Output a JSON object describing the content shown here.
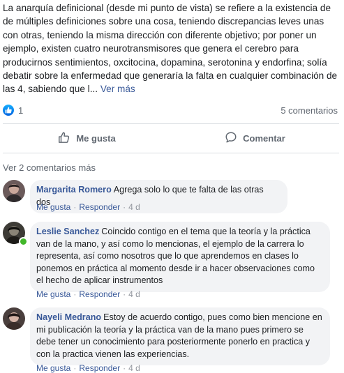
{
  "post": {
    "text": "La anarquía definicional (desde mi punto de vista) se refiere a la existencia de de múltiples definiciones sobre una cosa, teniendo discrepancias leves unas con otras, teniendo la misma dirección con diferente objetivo; por poner un ejemplo, existen cuatro neurotransmisores que genera el cerebro para producirnos sentimientos, oxcitocina, dopamina, serotonina y endorfina; solía debatir sobre la enfermedad que generaría la falta en cualquier combinación de las 4, sabiendo que l...",
    "see_more": "Ver más"
  },
  "reactions": {
    "like_count": "1",
    "comments_count": "5 comentarios",
    "reaction_icon": "thumbs-up-icon"
  },
  "actions": {
    "like_label": "Me gusta",
    "comment_label": "Comentar"
  },
  "comments_section": {
    "view_more": "Ver 2 comentarios más",
    "items": [
      {
        "author": "Margarita Romero",
        "text": "Agrega solo lo que te falta de las otras dos",
        "like": "Me gusta",
        "reply": "Responder",
        "time": "4 d"
      },
      {
        "author": "Leslie Sanchez",
        "text": "Coincido contigo en el tema que la teoría y la práctica van de la mano, y así como lo mencionas, el ejemplo de la carrera lo representa, así como nosotros que lo que aprendemos en clases lo ponemos en práctica al momento desde ir a hacer observaciones como el hecho de aplicar instrumentos",
        "like": "Me gusta",
        "reply": "Responder",
        "time": "4 d"
      },
      {
        "author": "Nayeli Medrano",
        "text": "Estoy de acuerdo contigo, pues como bien mencione en mi publicación la teoría y la práctica van de la mano pues primero se debe tener un conocimiento para posteriormente ponerlo en practica y con la practica vienen las experiencias.",
        "like": "Me gusta",
        "reply": "Responder",
        "time": "4 d"
      }
    ]
  },
  "colors": {
    "link": "#385898",
    "muted": "#606770",
    "bubble": "#f2f3f5",
    "online": "#42b72a"
  }
}
